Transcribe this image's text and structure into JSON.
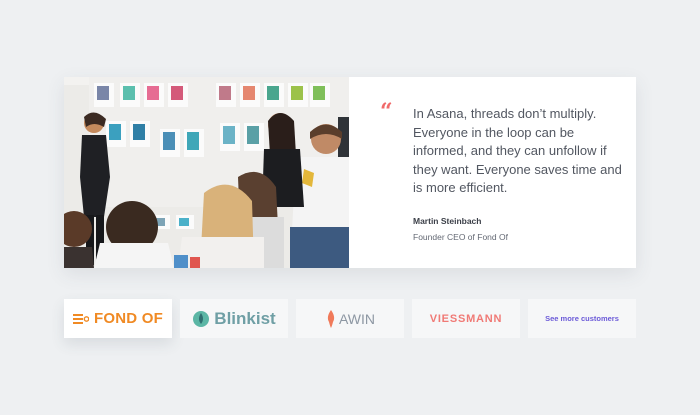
{
  "testimonial": {
    "quote_mark": "“",
    "quote": "In Asana, threads don’t multiply. Everyone in the loop can be informed, and they can unfollow if they want. Everyone saves time and is more efficient.",
    "author_name": "Martin Steinbach",
    "author_title": "Founder CEO of Fond Of"
  },
  "customers": [
    {
      "name": "FOND OF",
      "icon": "fondof-lines-icon",
      "color": "#f08a24",
      "active": true
    },
    {
      "name": "Blinkist",
      "icon": "blinkist-drop-icon",
      "color": "#6f9fa5",
      "active": false
    },
    {
      "name": "AWIN",
      "icon": "awin-flame-icon",
      "color": "#8d97a3",
      "active": false
    },
    {
      "name": "VIESSMANN",
      "icon": "",
      "color": "#f07a76",
      "active": false
    }
  ],
  "see_more": "See more customers",
  "colors": {
    "background": "#eef0f2",
    "accent": "#f06a6a",
    "link": "#6b5ad8"
  }
}
